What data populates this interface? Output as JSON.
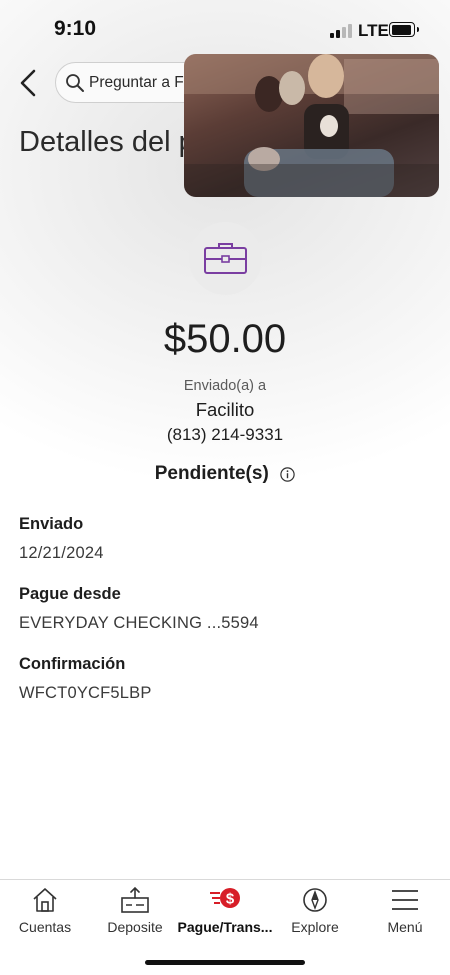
{
  "status_bar": {
    "time": "9:10",
    "network": "LTE",
    "signal_bars": 4,
    "signal_bars_active": 2,
    "battery_level": 0.85
  },
  "header": {
    "back_icon": "chevron-left-icon",
    "search": {
      "placeholder": "Preguntar a Fargo",
      "visible_value": "",
      "icon": "search-icon"
    },
    "title": "Detalles del pago"
  },
  "video_overlay": {
    "icon": "picture-in-picture-video"
  },
  "payment": {
    "icon": "briefcase-icon",
    "icon_color": "#7a3ea1",
    "amount": "$50.00",
    "sent_to_label": "Enviado(a) a",
    "recipient": "Facilito",
    "phone": "(813) 214-9331",
    "status": "Pendiente(s)",
    "status_icon": "info-icon"
  },
  "details": [
    {
      "label": "Enviado",
      "value": "12/21/2024"
    },
    {
      "label": "Pague desde",
      "value": "EVERYDAY CHECKING ...5594"
    },
    {
      "label": "Confirmación",
      "value": "WFCT0YCF5LBP"
    }
  ],
  "tabs": [
    {
      "label": "Cuentas",
      "icon": "home-icon",
      "active": false
    },
    {
      "label": "Deposite",
      "icon": "deposit-check-icon",
      "active": false
    },
    {
      "label": "Pague/Trans...",
      "icon": "pay-transfer-icon",
      "active": true
    },
    {
      "label": "Explore",
      "icon": "compass-icon",
      "active": false
    },
    {
      "label": "Menú",
      "icon": "menu-icon",
      "active": false
    }
  ],
  "colors": {
    "accent_red": "#d71e28",
    "brand_purple": "#7a3ea1"
  }
}
